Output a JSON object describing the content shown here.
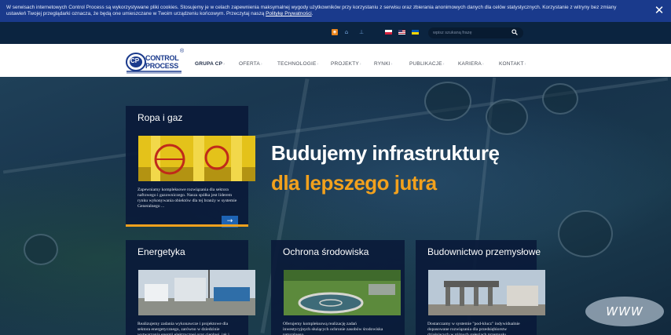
{
  "cookie": {
    "text": "W serwisach internetowych Control Process są wykorzystywane pliki cookies. Stosujemy je w celach zapewnienia maksymalnej wygody użytkowników przy korzystaniu z serwisu oraz zbierania anonimowych danych dla celów statystycznych. Korzystanie z witryny bez zmiany ustawień Twojej przeglądarki oznacza, że będą one umieszczane w Twoim urządzeniu końcowym. Przeczytaj naszą ",
    "link": "Politykę Prywatności",
    "text_end": ".",
    "close": "✕"
  },
  "utility": {
    "icons": [
      "rss-icon",
      "home-icon",
      "sitemap-icon"
    ],
    "flags": [
      "flag-pl",
      "flag-en",
      "flag-ua"
    ],
    "search_placeholder": "wpisz szukaną frazę",
    "search_icon": "search-icon"
  },
  "logo": {
    "line1": "CONTROL",
    "line2": "PROCESS",
    "mark": "CP",
    "registered": "®"
  },
  "nav": [
    {
      "label": "GRUPA CP"
    },
    {
      "label": "OFERTA"
    },
    {
      "label": "TECHNOLOGIE"
    },
    {
      "label": "PROJEKTY"
    },
    {
      "label": "RYNKI"
    },
    {
      "label": "PUBLIKACJE"
    },
    {
      "label": "KARIERA"
    },
    {
      "label": "KONTAKT"
    }
  ],
  "nav_arrow": "›",
  "hero": {
    "line1": "Budujemy infrastrukturę",
    "line2": "dla lepszego jutra"
  },
  "cards": [
    {
      "title": "Ropa i gaz",
      "desc": "Zapewniamy kompleksowe rozwiązania dla sektora naftowego i gazowniczego. Nasza spółka jest liderem rynku wykonywania obiektów dla tej branży w systemie Generalnego ..."
    },
    {
      "title": "Energetyka",
      "desc": "Realizujemy zadania wykonawcze i projektowe dla sektora energetycznego, zarówno w dziedzinie wytwarzania energii elektrycznej oraz cieplnej, jak i ..."
    },
    {
      "title": "Ochrona środowiska",
      "desc": "Oferujemy kompleksową realizację zadań inwestycyjnych służących ochronie zasobów środowiska naturalnego ..."
    },
    {
      "title": "Budownictwo przemysłowe",
      "desc": "Dostarczamy w systemie \"pod-klucz\" indywidualnie dopasowane rozwiązania dla przedsiębiorstw działających w różnych gałęziach przemysłu ..."
    }
  ],
  "card_arrow": "→",
  "www": "WWW",
  "colors": {
    "accent": "#f2a11d",
    "brand_blue": "#1a3a8c",
    "arrow_button": "#1d63b3"
  }
}
